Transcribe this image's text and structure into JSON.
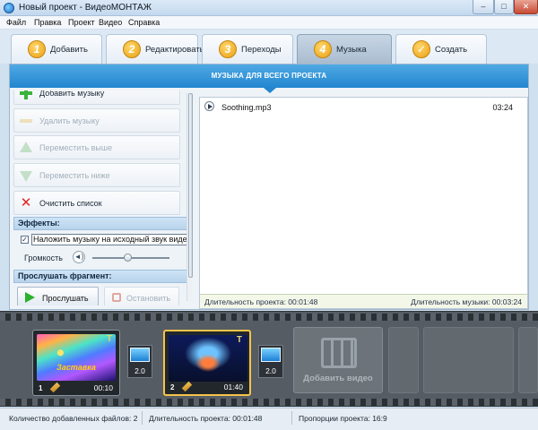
{
  "window": {
    "title": "Новый проект - ВидеоМОНТАЖ",
    "controls": {
      "minimize": "–",
      "maximize": "□",
      "close": "✕"
    }
  },
  "menu": [
    "Файл",
    "Правка",
    "Проект",
    "Видео",
    "Справка"
  ],
  "steps": [
    {
      "num": "1",
      "label": "Добавить",
      "active": false
    },
    {
      "num": "2",
      "label": "Редактировать",
      "active": false
    },
    {
      "num": "3",
      "label": "Переходы",
      "active": false
    },
    {
      "num": "4",
      "label": "Музыка",
      "active": true
    },
    {
      "num": "✓",
      "label": "Создать",
      "active": false
    }
  ],
  "music_panel": {
    "header": "МУЗЫКА ДЛЯ ВСЕГО ПРОЕКТА",
    "actions": [
      {
        "label": "Добавить музыку",
        "icon": "plus-icon",
        "enabled": true
      },
      {
        "label": "Удалить музыку",
        "icon": "minus-icon",
        "enabled": false
      },
      {
        "label": "Переместить выше",
        "icon": "arrow-up-icon",
        "enabled": false
      },
      {
        "label": "Переместить ниже",
        "icon": "arrow-down-icon",
        "enabled": false
      },
      {
        "label": "Очистить список",
        "icon": "delete-x-icon",
        "enabled": true
      }
    ],
    "effects_header": "Эффекты:",
    "overlay_checkbox_label": "Наложить музыку на исходный звук видео",
    "overlay_checked": true,
    "volume_label": "Громкость",
    "volume_level": 0.45,
    "preview_header": "Прослушать фрагмент:",
    "play_label": "Прослушать",
    "stop_label": "Остановить"
  },
  "tracks": [
    {
      "name": "Soothing.mp3",
      "duration": "03:24"
    }
  ],
  "list_footer": {
    "project_duration": "Длительность проекта: 00:01:48",
    "music_duration": "Длительность музыки: 00:03:24"
  },
  "timeline": {
    "clips": [
      {
        "num": "1",
        "time": "00:10",
        "caption": "Заставка",
        "selected": false
      },
      {
        "num": "2",
        "time": "01:40",
        "caption": "",
        "selected": true
      }
    ],
    "transitions": [
      "2.0",
      "2.0"
    ],
    "add_video_label": "Добавить видео",
    "overlay_mark": "T"
  },
  "status": {
    "files": "Количество добавленных файлов: 2",
    "duration": "Длительность проекта: 00:01:48",
    "proportions": "Пропорции проекта: 16:9"
  },
  "colors": {
    "accent": "#2386cf",
    "tab_badge": "#e9a114",
    "selected_clip": "#f5c44a"
  }
}
